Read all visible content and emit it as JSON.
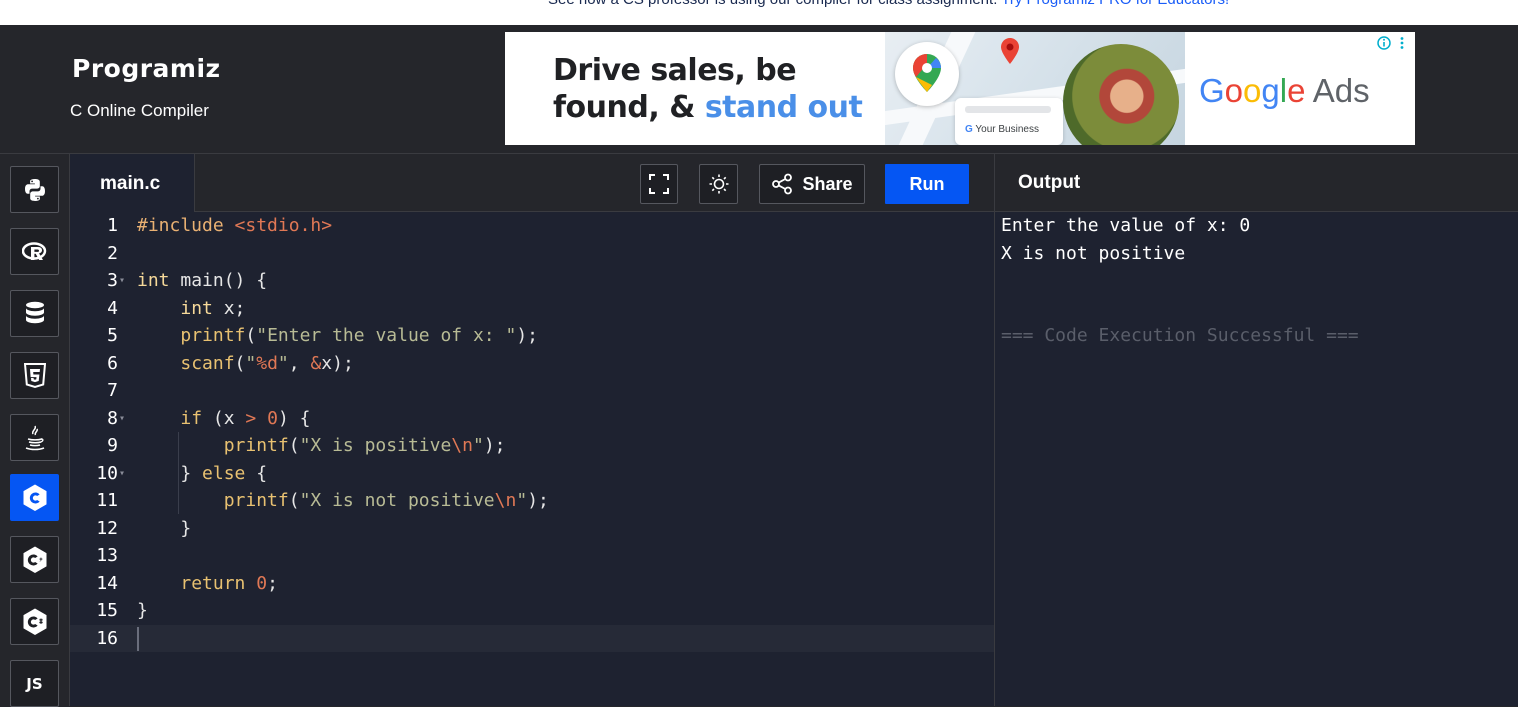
{
  "banner": {
    "message": "See how a CS professor is using our compiler for class assignment.",
    "link": "Try Programiz PRO for Educators!"
  },
  "header": {
    "logo": "Programiz",
    "subtitle": "C Online Compiler"
  },
  "ad": {
    "headline_line1": "Drive sales, be",
    "headline_line2_plain": "found, & ",
    "headline_line2_accent": "stand out",
    "business_label": "Your Business",
    "brand_parts": [
      "G",
      "o",
      "o",
      "g",
      "l",
      "e",
      " Ads"
    ],
    "info_icon": "info-icon",
    "menu_icon": "kebab-icon"
  },
  "languages": [
    {
      "name": "python",
      "icon": "python-icon"
    },
    {
      "name": "r",
      "icon": "r-icon"
    },
    {
      "name": "sql",
      "icon": "database-icon"
    },
    {
      "name": "html",
      "icon": "html5-icon"
    },
    {
      "name": "java",
      "icon": "java-icon"
    },
    {
      "name": "c",
      "icon": "c-icon",
      "active": true
    },
    {
      "name": "cpp",
      "icon": "cpp-icon"
    },
    {
      "name": "csharp",
      "icon": "csharp-icon"
    },
    {
      "name": "js",
      "icon": "js-icon",
      "text": "JS"
    }
  ],
  "editor": {
    "filename": "main.c",
    "share_label": "Share",
    "run_label": "Run",
    "line_numbers": [
      "1",
      "2",
      "3",
      "4",
      "5",
      "6",
      "7",
      "8",
      "9",
      "10",
      "11",
      "12",
      "13",
      "14",
      "15",
      "16"
    ],
    "fold_lines": [
      3,
      8,
      10
    ],
    "current_line": 16
  },
  "code_tokens": {
    "include_kw": "#include",
    "include_file": "<stdio.h>",
    "l3_type": "int",
    "l3_rest": " main() {",
    "l4_type": "int",
    "l4_rest": " x;",
    "l5_fn": "printf",
    "l5_str": "\"Enter the value of x: \"",
    "l5_end": ");",
    "l6_fn": "scanf",
    "l6_q1": "\"",
    "l6_fmt": "%d",
    "l6_q2": "\"",
    "l6_comma": ", ",
    "l6_amp": "&",
    "l6_end": "x);",
    "l8_if": "if",
    "l8_a": " (x ",
    "l8_op": ">",
    "l8_b": " ",
    "l8_zero": "0",
    "l8_c": ") {",
    "l9_fn": "printf",
    "l9_str": "\"X is positive",
    "l9_esc": "\\n",
    "l9_q": "\"",
    "l9_end": ");",
    "l10_a": "} ",
    "l10_else": "else",
    "l10_b": " {",
    "l11_fn": "printf",
    "l11_str": "\"X is not positive",
    "l11_esc": "\\n",
    "l11_q": "\"",
    "l11_end": ");",
    "l12": "}",
    "l14_ret": "return",
    "l14_sp": " ",
    "l14_zero": "0",
    "l14_end": ";",
    "l15": "}"
  },
  "output": {
    "title": "Output",
    "lines": [
      "Enter the value of x: 0",
      "X is not positive"
    ],
    "status": "=== Code Execution Successful ==="
  }
}
